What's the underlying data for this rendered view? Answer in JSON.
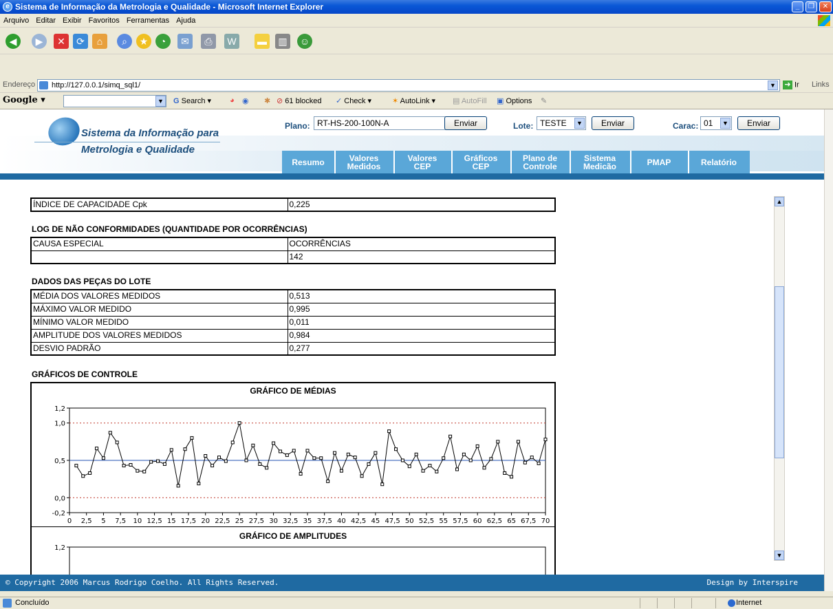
{
  "window": {
    "title": "Sistema de Informação da Metrologia e Qualidade - Microsoft Internet Explorer"
  },
  "menu": [
    "Arquivo",
    "Editar",
    "Exibir",
    "Favoritos",
    "Ferramentas",
    "Ajuda"
  ],
  "address": {
    "label": "Endereço",
    "url": "http://127.0.0.1/simq_sql1/",
    "go": "Ir",
    "links": "Links"
  },
  "google": {
    "logo": "Google",
    "search": "Search",
    "blocked": "61 blocked",
    "check": "Check",
    "autolink": "AutoLink",
    "autofill": "AutoFill",
    "options": "Options"
  },
  "site": {
    "logo_line1": "Sistema da Informação para",
    "logo_line2": "Metrologia e Qualidade",
    "plano_label": "Plano:",
    "plano_value": "RT-HS-200-100N-A",
    "lote_label": "Lote:",
    "lote_value": "TESTE",
    "carac_label": "Carac:",
    "carac_value": "01",
    "enviar": "Enviar",
    "tabs": [
      {
        "l1": "Resumo",
        "l2": ""
      },
      {
        "l1": "Valores",
        "l2": "Medidos"
      },
      {
        "l1": "Valores",
        "l2": "CEP"
      },
      {
        "l1": "Gráficos",
        "l2": "CEP"
      },
      {
        "l1": "Plano de",
        "l2": "Controle"
      },
      {
        "l1": "Sistema",
        "l2": "Medicão"
      },
      {
        "l1": "PMAP",
        "l2": ""
      },
      {
        "l1": "Relatório",
        "l2": ""
      }
    ]
  },
  "cpk": {
    "label": "ÍNDICE DE CAPACIDADE Cpk",
    "value": "0,225"
  },
  "log": {
    "title": "LOG DE NÃO CONFORMIDADES (QUANTIDADE POR OCORRÊNCIAS)",
    "h1": "CAUSA ESPECIAL",
    "h2": "OCORRÊNCIAS",
    "r1": "",
    "r2": "142"
  },
  "lote": {
    "title": "DADOS DAS PEÇAS DO LOTE",
    "rows": [
      {
        "k": "MÉDIA DOS VALORES MEDIDOS",
        "v": "0,513"
      },
      {
        "k": "MÁXIMO VALOR MEDIDO",
        "v": "0,995"
      },
      {
        "k": "MÍNIMO VALOR MEDIDO",
        "v": "0,011"
      },
      {
        "k": "AMPLITUDE DOS VALORES MEDIDOS",
        "v": "0,984"
      },
      {
        "k": "DESVIO PADRÃO",
        "v": "0,277"
      }
    ]
  },
  "graficos_title": "GRÁFICOS DE CONTROLE",
  "chart_data": [
    {
      "type": "line",
      "title": "GRÁFICO DE MÉDIAS",
      "xlim": [
        0,
        70
      ],
      "ylim": [
        -0.2,
        1.2
      ],
      "yticks": [
        "1,2",
        "1,0",
        "0,5",
        "0,0",
        "-0,2"
      ],
      "ytick_values": [
        1.2,
        1.0,
        0.5,
        0.0,
        -0.2
      ],
      "xticks": [
        "0",
        "2,5",
        "5",
        "7,5",
        "10",
        "12,5",
        "15",
        "17,5",
        "20",
        "22,5",
        "25",
        "27,5",
        "30",
        "32,5",
        "35",
        "37,5",
        "40",
        "42,5",
        "45",
        "47,5",
        "50",
        "52,5",
        "55",
        "57,5",
        "60",
        "62,5",
        "65",
        "67,5",
        "70"
      ],
      "center_line": 0.5,
      "ucl": 1.0,
      "lcl": 0.0,
      "x": [
        1,
        2,
        3,
        4,
        5,
        6,
        7,
        8,
        9,
        10,
        11,
        12,
        13,
        14,
        15,
        16,
        17,
        18,
        19,
        20,
        21,
        22,
        23,
        24,
        25,
        26,
        27,
        28,
        29,
        30,
        31,
        32,
        33,
        34,
        35,
        36,
        37,
        38,
        39,
        40,
        41,
        42,
        43,
        44,
        45,
        46,
        47,
        48,
        49,
        50,
        51,
        52,
        53,
        54,
        55,
        56,
        57,
        58,
        59,
        60,
        61,
        62,
        63,
        64,
        65,
        66,
        67,
        68,
        69,
        70
      ],
      "values": [
        0.43,
        0.29,
        0.33,
        0.66,
        0.53,
        0.87,
        0.74,
        0.43,
        0.44,
        0.36,
        0.35,
        0.48,
        0.49,
        0.45,
        0.64,
        0.16,
        0.65,
        0.8,
        0.19,
        0.56,
        0.43,
        0.54,
        0.49,
        0.74,
        1.0,
        0.5,
        0.7,
        0.45,
        0.4,
        0.73,
        0.62,
        0.57,
        0.63,
        0.32,
        0.63,
        0.53,
        0.53,
        0.22,
        0.6,
        0.36,
        0.58,
        0.54,
        0.29,
        0.45,
        0.6,
        0.18,
        0.89,
        0.65,
        0.5,
        0.42,
        0.58,
        0.36,
        0.43,
        0.35,
        0.53,
        0.82,
        0.38,
        0.58,
        0.5,
        0.69,
        0.4,
        0.52,
        0.75,
        0.33,
        0.28,
        0.75,
        0.47,
        0.54,
        0.46,
        0.78
      ]
    },
    {
      "type": "line",
      "title": "GRÁFICO DE AMPLITUDES",
      "yticks": [
        "1,2"
      ]
    }
  ],
  "footer": {
    "left": "© Copyright 2006 Marcus Rodrigo Coelho. All Rights Reserved.",
    "right": "Design by Interspire"
  },
  "status": {
    "text": "Concluído",
    "zone": "Internet"
  }
}
